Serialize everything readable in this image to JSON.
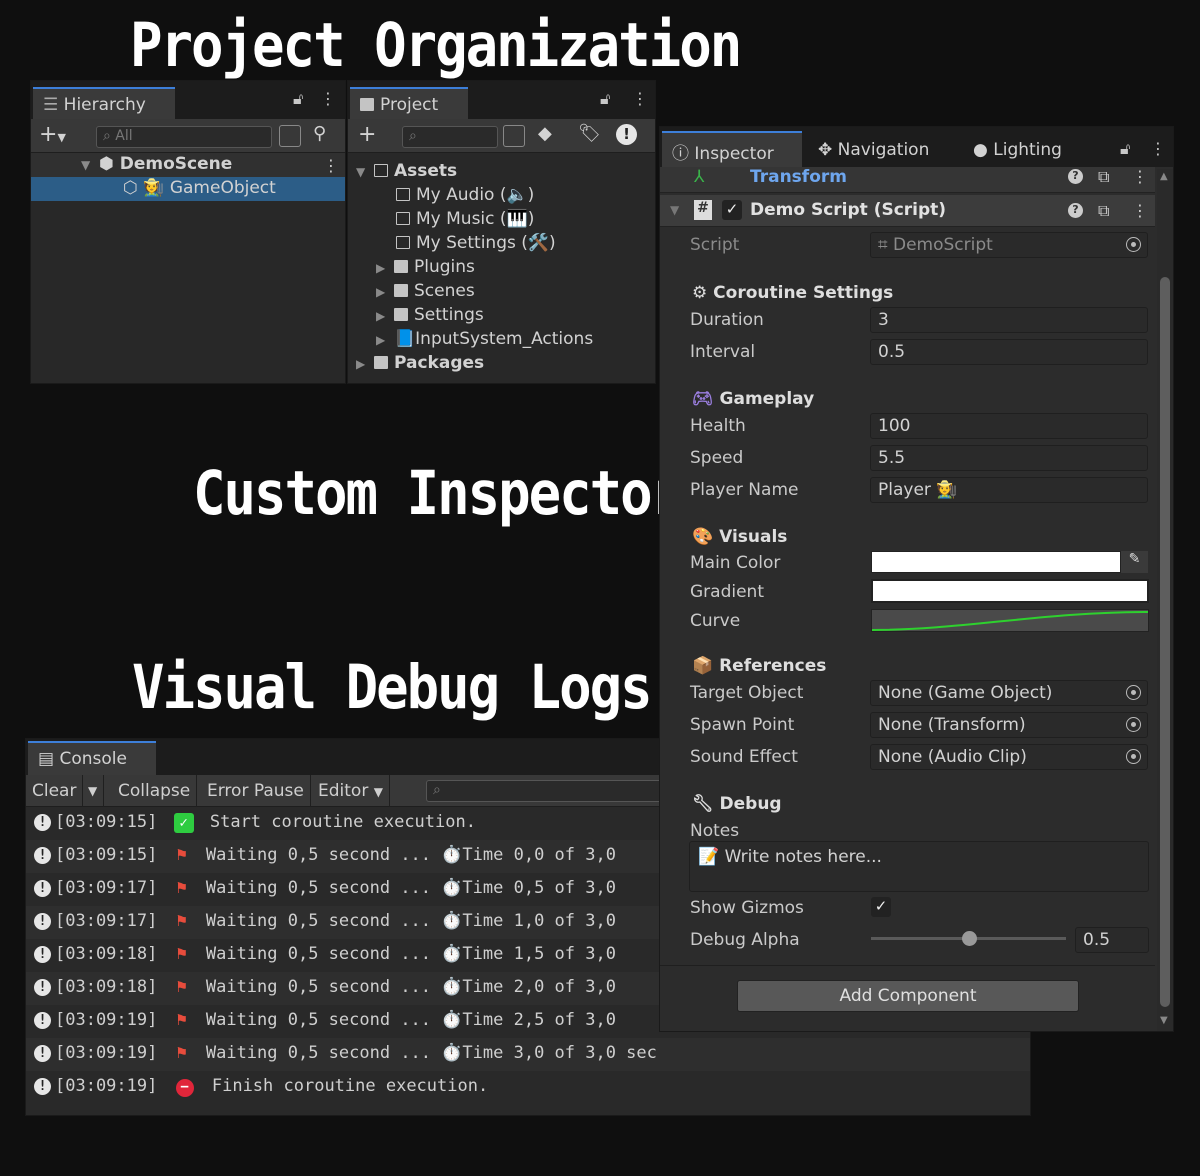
{
  "headings": {
    "project": "Project Organization",
    "inspectors": "Custom Inspectors",
    "logs": "Visual Debug Logs"
  },
  "hierarchy": {
    "tab": "Hierarchy",
    "search": "All",
    "scene": "DemoScene",
    "object": "GameObject"
  },
  "project": {
    "tab": "Project",
    "assets": "Assets",
    "items": [
      "My Audio (🔈)",
      "My Music (🎹)",
      "My Settings (🛠️)",
      "Plugins",
      "Scenes",
      "Settings",
      "InputSystem_Actions"
    ],
    "packages": "Packages"
  },
  "inspector": {
    "tabs": [
      "Inspector",
      "Navigation",
      "Lighting"
    ],
    "transform": "Transform",
    "component": "Demo Script (Script)",
    "script_label": "Script",
    "script_value": "DemoScript",
    "sections": {
      "coroutine": "Coroutine Settings",
      "gameplay": "Gameplay",
      "visuals": "Visuals",
      "references": "References",
      "debug": "Debug"
    },
    "duration_label": "Duration",
    "duration": "3",
    "interval_label": "Interval",
    "interval": "0.5",
    "health_label": "Health",
    "health": "100",
    "speed_label": "Speed",
    "speed": "5.5",
    "player_label": "Player Name",
    "player": "Player 🧑‍🌾",
    "color_label": "Main Color",
    "gradient_label": "Gradient",
    "curve_label": "Curve",
    "target_label": "Target Object",
    "target": "None (Game Object)",
    "spawn_label": "Spawn Point",
    "spawn": "None (Transform)",
    "sound_label": "Sound Effect",
    "sound": "None (Audio Clip)",
    "notes_label": "Notes",
    "notes": "📝 Write notes here...",
    "gizmos_label": "Show Gizmos",
    "gizmos": true,
    "alpha_label": "Debug Alpha",
    "alpha": "0.5",
    "add": "Add Component",
    "colors": {
      "curve": "#2ed12e",
      "accent": "#3d7fd9"
    }
  },
  "console": {
    "tab": "Console",
    "buttons": [
      "Clear",
      "Collapse",
      "Error Pause",
      "Editor"
    ],
    "rows": [
      {
        "time": "[03:09:15]",
        "icon": "check",
        "msg": "Start coroutine execution."
      },
      {
        "time": "[03:09:15]",
        "icon": "flag",
        "msg": "Waiting 0,5 second ... ⏱️Time 0,0 of 3,0"
      },
      {
        "time": "[03:09:17]",
        "icon": "flag",
        "msg": "Waiting 0,5 second ... ⏱️Time 0,5 of 3,0"
      },
      {
        "time": "[03:09:17]",
        "icon": "flag",
        "msg": "Waiting 0,5 second ... ⏱️Time 1,0 of 3,0"
      },
      {
        "time": "[03:09:18]",
        "icon": "flag",
        "msg": "Waiting 0,5 second ... ⏱️Time 1,5 of 3,0"
      },
      {
        "time": "[03:09:18]",
        "icon": "flag",
        "msg": "Waiting 0,5 second ... ⏱️Time 2,0 of 3,0"
      },
      {
        "time": "[03:09:19]",
        "icon": "flag",
        "msg": "Waiting 0,5 second ... ⏱️Time 2,5 of 3,0"
      },
      {
        "time": "[03:09:19]",
        "icon": "flag",
        "msg": "Waiting 0,5 second ... ⏱️Time 3,0 of 3,0 sec"
      },
      {
        "time": "[03:09:19]",
        "icon": "stop",
        "msg": "Finish coroutine execution."
      }
    ]
  }
}
